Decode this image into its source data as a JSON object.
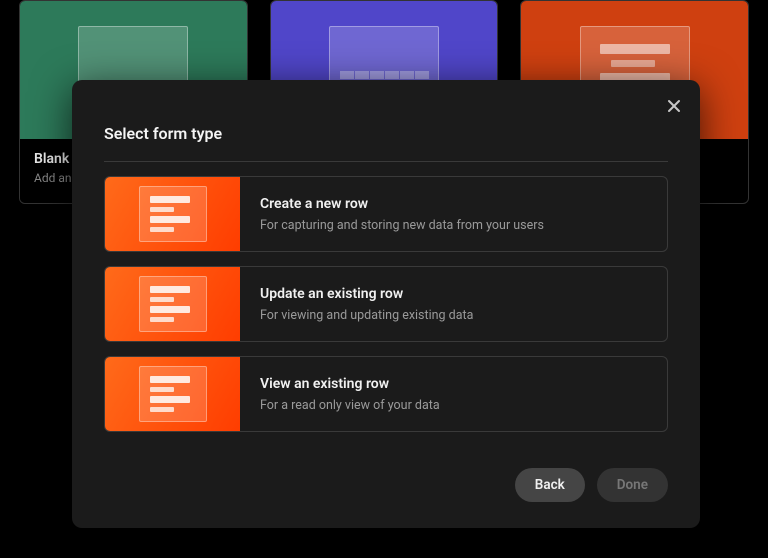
{
  "background_cards": [
    {
      "title": "Blank",
      "subtitle": "Add an"
    }
  ],
  "modal": {
    "title": "Select form type",
    "options": [
      {
        "title": "Create a new row",
        "subtitle": "For capturing and storing new data from your users"
      },
      {
        "title": "Update an existing row",
        "subtitle": "For viewing and updating existing data"
      },
      {
        "title": "View an existing row",
        "subtitle": "For a read only view of your data"
      }
    ],
    "buttons": {
      "back": "Back",
      "done": "Done"
    }
  }
}
